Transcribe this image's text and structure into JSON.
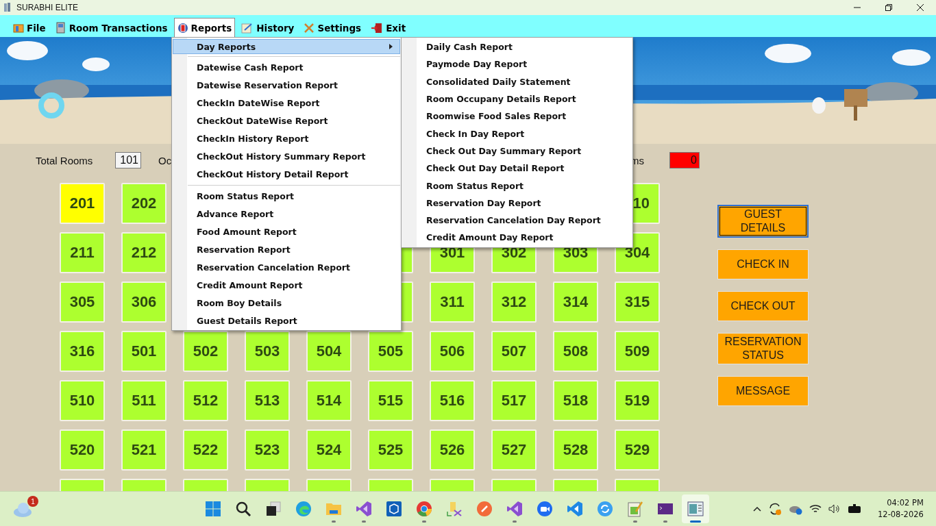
{
  "window": {
    "title": "SURABHI ELITE"
  },
  "menu_bar": [
    {
      "kind": "file",
      "label": "File",
      "selected": false
    },
    {
      "kind": "rooms",
      "label": "Room  Transactions",
      "selected": false
    },
    {
      "kind": "reports",
      "label": "Reports",
      "selected": true
    },
    {
      "kind": "history",
      "label": "History",
      "selected": false
    },
    {
      "kind": "settings",
      "label": "Settings",
      "selected": false
    },
    {
      "kind": "exit",
      "label": "Exit",
      "selected": false
    }
  ],
  "reports_menu": [
    {
      "kind": "submenu",
      "label": "Day Reports",
      "selected": true
    },
    {
      "kind": "separator"
    },
    {
      "kind": "item",
      "label": "Datewise Cash Report",
      "selected": false
    },
    {
      "kind": "item",
      "label": "Datewise Reservation Report",
      "selected": false
    },
    {
      "kind": "item",
      "label": "CheckIn DateWise Report",
      "selected": false
    },
    {
      "kind": "item",
      "label": "CheckOut DateWise Report",
      "selected": false
    },
    {
      "kind": "item",
      "label": "CheckIn History Report",
      "selected": false
    },
    {
      "kind": "item",
      "label": "CheckOut History Summary Report",
      "selected": false
    },
    {
      "kind": "item",
      "label": "CheckOut History Detail Report",
      "selected": false
    },
    {
      "kind": "separator"
    },
    {
      "kind": "item",
      "label": "Room Status Report",
      "selected": false
    },
    {
      "kind": "item",
      "label": "Advance Report",
      "selected": false
    },
    {
      "kind": "item",
      "label": "Food Amount Report",
      "selected": false
    },
    {
      "kind": "item",
      "label": "Reservation Report",
      "selected": false
    },
    {
      "kind": "item",
      "label": "Reservation Cancelation Report",
      "selected": false
    },
    {
      "kind": "item",
      "label": "Credit Amount Report",
      "selected": false
    },
    {
      "kind": "item",
      "label": "Room Boy Details",
      "selected": false
    },
    {
      "kind": "item",
      "label": "Guest Details Report",
      "selected": false
    }
  ],
  "day_reports_submenu": [
    {
      "label": "Daily Cash Report",
      "selected": false
    },
    {
      "label": "Paymode Day Report",
      "selected": false
    },
    {
      "label": "Consolidated Daily Statement",
      "selected": false
    },
    {
      "label": "Room Occupany Details Report",
      "selected": false
    },
    {
      "label": "Roomwise Food Sales Report",
      "selected": false
    },
    {
      "label": "Check In Day Report",
      "selected": false
    },
    {
      "label": "Check Out Day Summary Report",
      "selected": false
    },
    {
      "label": "Check Out Day Detail Report",
      "selected": false
    },
    {
      "label": "Room Status Report",
      "selected": false
    },
    {
      "label": "Reservation Day Report",
      "selected": false
    },
    {
      "label": "Reservation Cancelation Day Report",
      "selected": false
    },
    {
      "label": "Credit Amount Day Report",
      "selected": false
    }
  ],
  "stats": {
    "total_rooms_label": "Total Rooms",
    "total_rooms": "101",
    "column_2_label": "Oc",
    "column_3_label": "ms",
    "column_3_value": "0"
  },
  "rooms": [
    [
      {
        "kind": "tile",
        "label": "201",
        "color": "#ffff00"
      },
      {
        "kind": "tile",
        "label": "202",
        "color": "#adff2f"
      },
      {
        "kind": "covered"
      },
      {
        "kind": "covered"
      },
      {
        "kind": "covered"
      },
      {
        "kind": "covered"
      },
      {
        "kind": "covered"
      },
      {
        "kind": "covered"
      },
      {
        "kind": "covered"
      },
      {
        "kind": "cut_tile",
        "label": "10",
        "color": "#adff2f"
      }
    ],
    [
      {
        "kind": "tile",
        "label": "211",
        "color": "#adff2f"
      },
      {
        "kind": "tile",
        "label": "212",
        "color": "#adff2f"
      },
      {
        "kind": "covered"
      },
      {
        "kind": "covered"
      },
      {
        "kind": "covered"
      },
      {
        "kind": "tile",
        "color": "#adff2f"
      },
      {
        "kind": "tile",
        "label": "301",
        "color": "#adff2f"
      },
      {
        "kind": "tile",
        "label": "302",
        "color": "#adff2f"
      },
      {
        "kind": "tile",
        "label": "303",
        "color": "#adff2f"
      },
      {
        "kind": "tile",
        "label": "304",
        "color": "#adff2f"
      }
    ],
    [
      {
        "kind": "tile",
        "label": "305",
        "color": "#adff2f"
      },
      {
        "kind": "tile",
        "label": "306",
        "color": "#adff2f"
      },
      {
        "kind": "covered"
      },
      {
        "kind": "covered"
      },
      {
        "kind": "covered"
      },
      {
        "kind": "tile",
        "color": "#adff2f"
      },
      {
        "kind": "tile",
        "label": "311",
        "color": "#adff2f"
      },
      {
        "kind": "tile",
        "label": "312",
        "color": "#adff2f"
      },
      {
        "kind": "tile",
        "label": "314",
        "color": "#adff2f"
      },
      {
        "kind": "tile",
        "label": "315",
        "color": "#adff2f"
      }
    ],
    [
      {
        "kind": "tile",
        "label": "316",
        "color": "#adff2f"
      },
      {
        "kind": "tile",
        "label": "501",
        "color": "#adff2f"
      },
      {
        "kind": "tile",
        "label": "502",
        "color": "#adff2f"
      },
      {
        "kind": "tile",
        "label": "503",
        "color": "#adff2f"
      },
      {
        "kind": "tile",
        "label": "504",
        "color": "#adff2f"
      },
      {
        "kind": "tile",
        "label": "505",
        "color": "#adff2f"
      },
      {
        "kind": "tile",
        "label": "506",
        "color": "#adff2f"
      },
      {
        "kind": "tile",
        "label": "507",
        "color": "#adff2f"
      },
      {
        "kind": "tile",
        "label": "508",
        "color": "#adff2f"
      },
      {
        "kind": "tile",
        "label": "509",
        "color": "#adff2f"
      }
    ],
    [
      {
        "kind": "tile",
        "label": "510",
        "color": "#adff2f"
      },
      {
        "kind": "tile",
        "label": "511",
        "color": "#adff2f"
      },
      {
        "kind": "tile",
        "label": "512",
        "color": "#adff2f"
      },
      {
        "kind": "tile",
        "label": "513",
        "color": "#adff2f"
      },
      {
        "kind": "tile",
        "label": "514",
        "color": "#adff2f"
      },
      {
        "kind": "tile",
        "label": "515",
        "color": "#adff2f"
      },
      {
        "kind": "tile",
        "label": "516",
        "color": "#adff2f"
      },
      {
        "kind": "tile",
        "label": "517",
        "color": "#adff2f"
      },
      {
        "kind": "tile",
        "label": "518",
        "color": "#adff2f"
      },
      {
        "kind": "tile",
        "label": "519",
        "color": "#adff2f"
      }
    ],
    [
      {
        "kind": "tile",
        "label": "520",
        "color": "#adff2f"
      },
      {
        "kind": "tile",
        "label": "521",
        "color": "#adff2f"
      },
      {
        "kind": "tile",
        "label": "522",
        "color": "#adff2f"
      },
      {
        "kind": "tile",
        "label": "523",
        "color": "#adff2f"
      },
      {
        "kind": "tile",
        "label": "524",
        "color": "#adff2f"
      },
      {
        "kind": "tile",
        "label": "525",
        "color": "#adff2f"
      },
      {
        "kind": "tile",
        "label": "526",
        "color": "#adff2f"
      },
      {
        "kind": "tile",
        "label": "527",
        "color": "#adff2f"
      },
      {
        "kind": "tile",
        "label": "528",
        "color": "#adff2f"
      },
      {
        "kind": "tile",
        "label": "529",
        "color": "#adff2f"
      }
    ],
    [
      {
        "kind": "tile",
        "color": "#adff2f"
      },
      {
        "kind": "tile",
        "color": "#adff2f"
      },
      {
        "kind": "tile",
        "color": "#adff2f"
      },
      {
        "kind": "tile",
        "color": "#adff2f"
      },
      {
        "kind": "tile",
        "color": "#adff2f"
      },
      {
        "kind": "tile",
        "color": "#adff2f"
      },
      {
        "kind": "tile",
        "color": "#adff2f"
      },
      {
        "kind": "tile",
        "color": "#adff2f"
      },
      {
        "kind": "tile",
        "color": "#adff2f"
      },
      {
        "kind": "tile",
        "color": "#adff2f"
      }
    ]
  ],
  "actions": [
    {
      "label": "GUEST DETAILS",
      "selected": true
    },
    {
      "label": "CHECK IN",
      "selected": false
    },
    {
      "label": "CHECK OUT",
      "selected": false
    },
    {
      "label": "RESERVATION STATUS",
      "selected": false
    },
    {
      "label": "MESSAGE",
      "selected": false
    }
  ],
  "taskbar": {
    "weather_badge": "1",
    "apps": [
      {
        "kind": "start",
        "running": false,
        "selected": false
      },
      {
        "kind": "search",
        "running": false,
        "selected": false
      },
      {
        "kind": "taskview",
        "running": false,
        "selected": false
      },
      {
        "kind": "edge",
        "running": false,
        "selected": false
      },
      {
        "kind": "explorer",
        "running": true,
        "selected": false
      },
      {
        "kind": "studio",
        "running": true,
        "selected": false
      },
      {
        "kind": "cube",
        "running": false,
        "selected": false
      },
      {
        "kind": "chrome",
        "running": true,
        "selected": false
      },
      {
        "kind": "tools",
        "running": false,
        "selected": false
      },
      {
        "kind": "postman",
        "running": false,
        "selected": false
      },
      {
        "kind": "studio",
        "running": true,
        "selected": false
      },
      {
        "kind": "zoom",
        "running": false,
        "selected": false
      },
      {
        "kind": "vscode",
        "running": false,
        "selected": false
      },
      {
        "kind": "sync",
        "running": false,
        "selected": false
      },
      {
        "kind": "notepad",
        "running": true,
        "selected": false
      },
      {
        "kind": "terminal",
        "running": true,
        "selected": false
      },
      {
        "kind": "app",
        "running": true,
        "selected": true
      }
    ],
    "time": "04:02 PM",
    "date": "12-08-2026"
  }
}
